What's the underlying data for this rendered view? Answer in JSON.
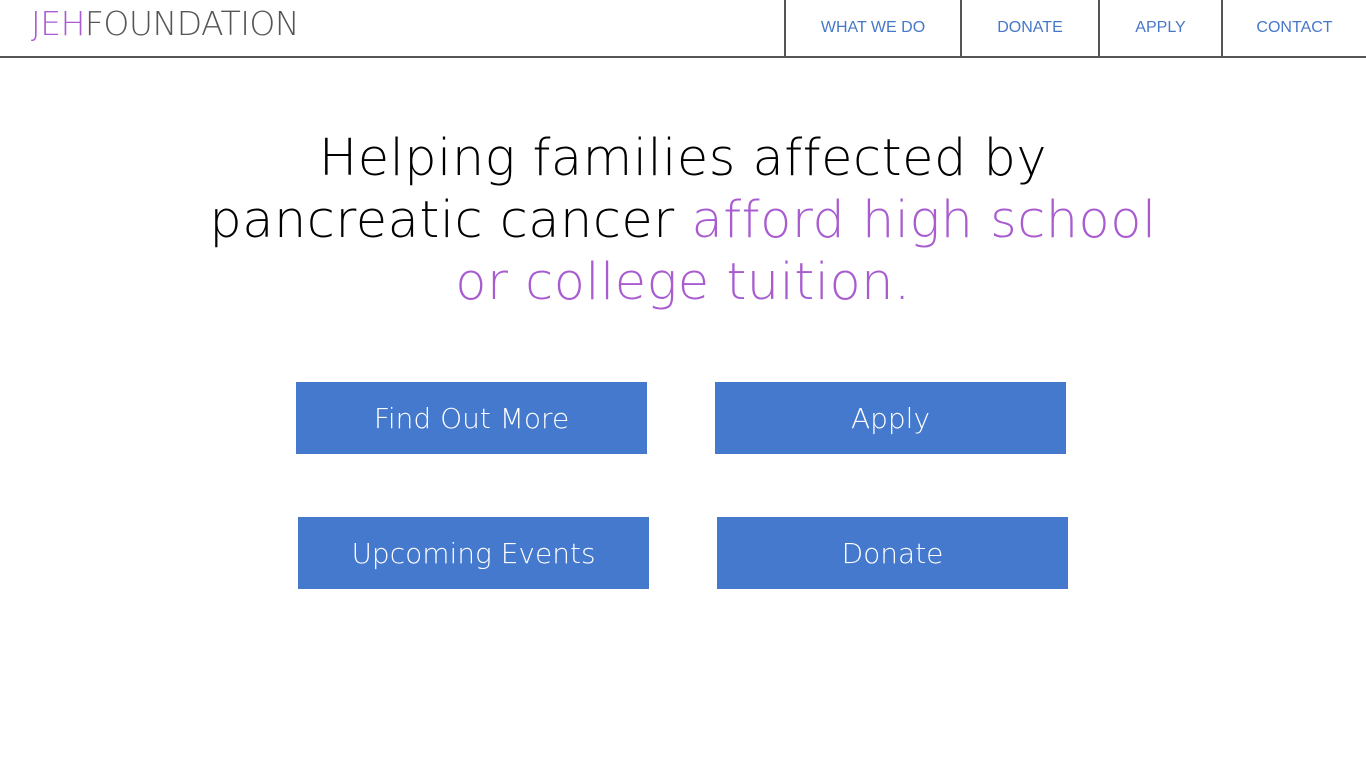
{
  "header": {
    "logo_accent": "JEH",
    "logo_main": "FOUNDATION",
    "nav": [
      {
        "label": "WHAT WE DO"
      },
      {
        "label": "DONATE"
      },
      {
        "label": "APPLY"
      },
      {
        "label": "CONTACT"
      }
    ]
  },
  "hero": {
    "text_plain": "Helping families affected by pancreatic cancer ",
    "text_accent": "afford high school or college tuition."
  },
  "buttons": [
    {
      "label": "Find Out More"
    },
    {
      "label": "Apply"
    },
    {
      "label": "Upcoming Events"
    },
    {
      "label": "Donate"
    }
  ],
  "colors": {
    "accent": "#a95cd0",
    "nav_link": "#4677c9",
    "button_bg": "#4579cd",
    "border": "#555555"
  }
}
